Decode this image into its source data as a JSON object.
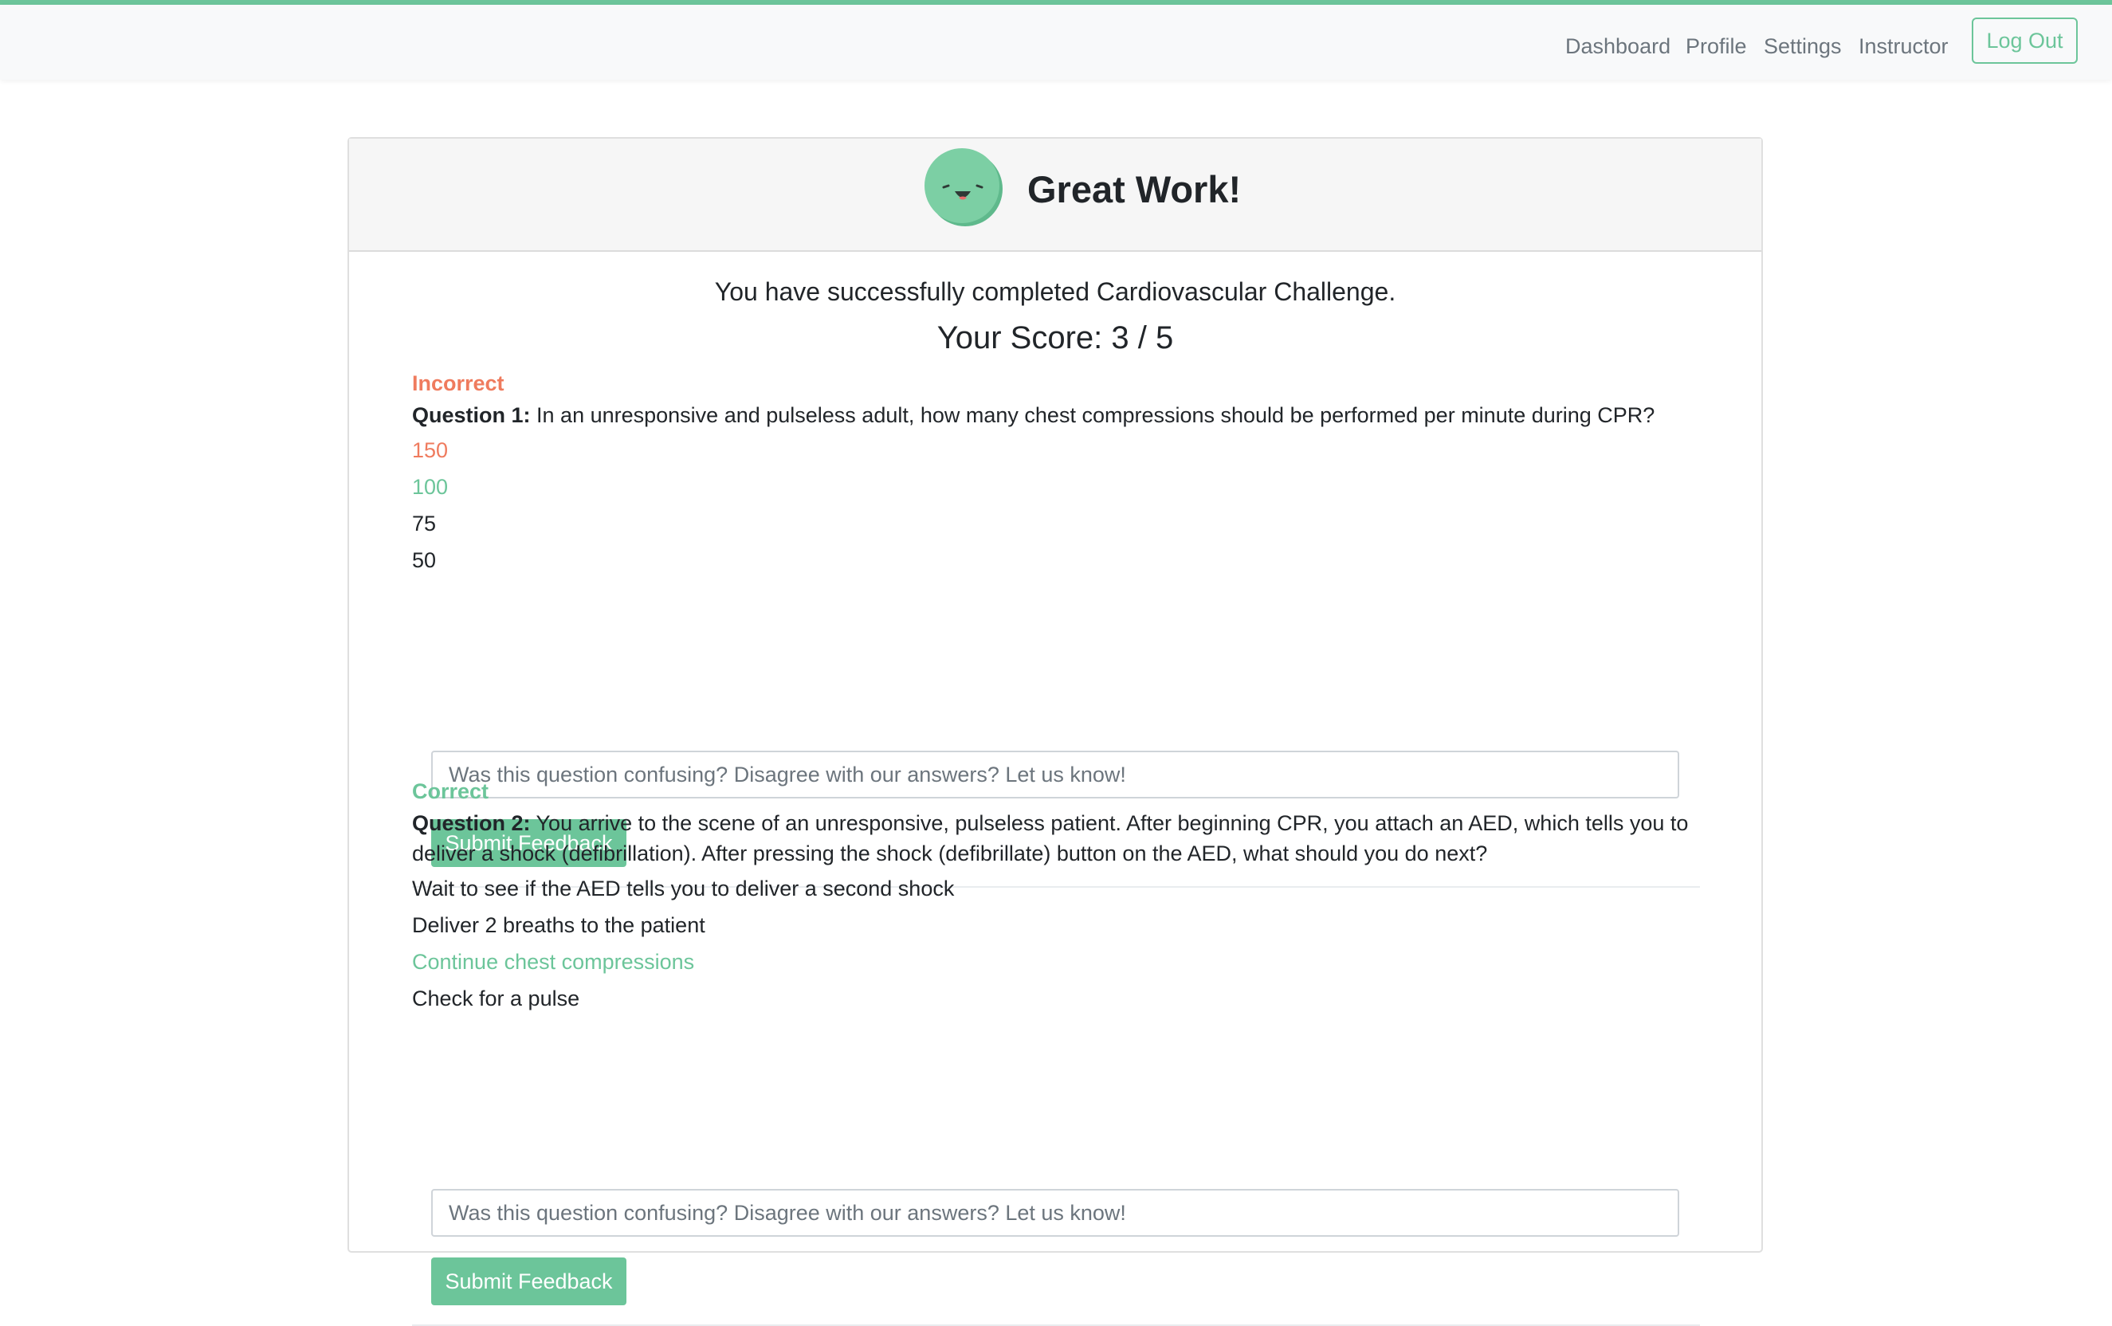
{
  "nav": {
    "links": [
      "Dashboard",
      "Profile",
      "Settings",
      "Instructor"
    ],
    "logout_label": "Log Out"
  },
  "header": {
    "title": "Great Work!",
    "mascot_icon": "smiling-face-icon"
  },
  "summary": {
    "completed_text": "You have successfully completed Cardiovascular Challenge.",
    "score_text": "Your Score: 3 / 5"
  },
  "questions": [
    {
      "status": "Incorrect",
      "label": "Question 1:",
      "text": "In an unresponsive and pulseless adult, how many chest compressions should be performed per minute during CPR?",
      "answers": [
        "150",
        "100",
        "75",
        "50"
      ],
      "feedback_placeholder": "Was this question confusing? Disagree with our answers? Let us know!",
      "submit_label": "Submit Feedback"
    },
    {
      "status": "Correct",
      "label": "Question 2:",
      "text": "You arrive to the scene of an unresponsive, pulseless patient. After beginning CPR, you attach an AED, which tells you to deliver a shock (defibrillation). After pressing the shock (defibrillate) button on the AED, what should you do next?",
      "answers": [
        "Wait to see if the AED tells you to deliver a second shock",
        "Deliver 2 breaths to the patient",
        "Continue chest compressions",
        "Check for a pulse"
      ],
      "feedback_placeholder": "Was this question confusing? Disagree with our answers? Let us know!",
      "submit_label": "Submit Feedback"
    }
  ],
  "colors": {
    "accent": "#6cc59a",
    "incorrect": "#ef7b5e"
  }
}
